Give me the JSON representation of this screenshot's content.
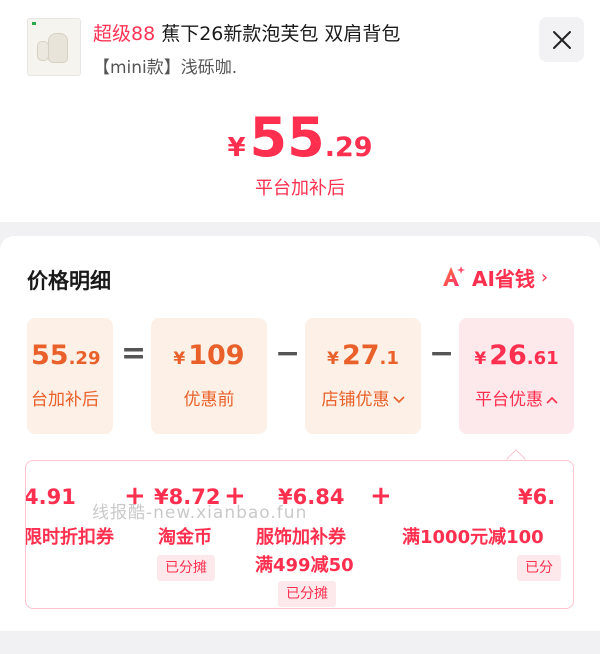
{
  "header": {
    "tag": "超级88",
    "title": "蕉下26新款泡芙包 双肩背包",
    "variant": "【mini款】浅砾咖."
  },
  "thumbnail": {
    "label": "蕉下 · 泡芙包MINI"
  },
  "price": {
    "yen": "¥",
    "int": "55",
    "dec": ".29",
    "caption": "平台加补后"
  },
  "detail": {
    "title": "价格明细",
    "ai_label": "AI省钱",
    "ai_chevron": "›",
    "boxes": [
      {
        "int": "55",
        "dec": ".29",
        "label": "台加补后",
        "yen": ""
      },
      {
        "yen": "¥",
        "int": "109",
        "dec": "",
        "label": "优惠前"
      },
      {
        "yen": "¥",
        "int": "27",
        "dec": ".1",
        "label": "店铺优惠"
      },
      {
        "yen": "¥",
        "int": "26",
        "dec": ".61",
        "label": "平台优惠"
      }
    ],
    "ops": [
      "=",
      "−",
      "−"
    ],
    "items": [
      {
        "value": "4.91",
        "name": "限时折扣券"
      },
      {
        "value": "¥8.72",
        "name": "淘金币",
        "badge": "已分摊"
      },
      {
        "value": "¥6.84",
        "name": "服饰加补券",
        "name2": "满499减50",
        "badge": "已分摊"
      },
      {
        "value": "¥6.",
        "name": "满1000元减100",
        "badge": "已分"
      }
    ],
    "plus": "+"
  },
  "watermark": "线报酷-new.xianbao.fun",
  "colors": {
    "accent": "#ff2f4f",
    "orange": "#e9602a"
  }
}
